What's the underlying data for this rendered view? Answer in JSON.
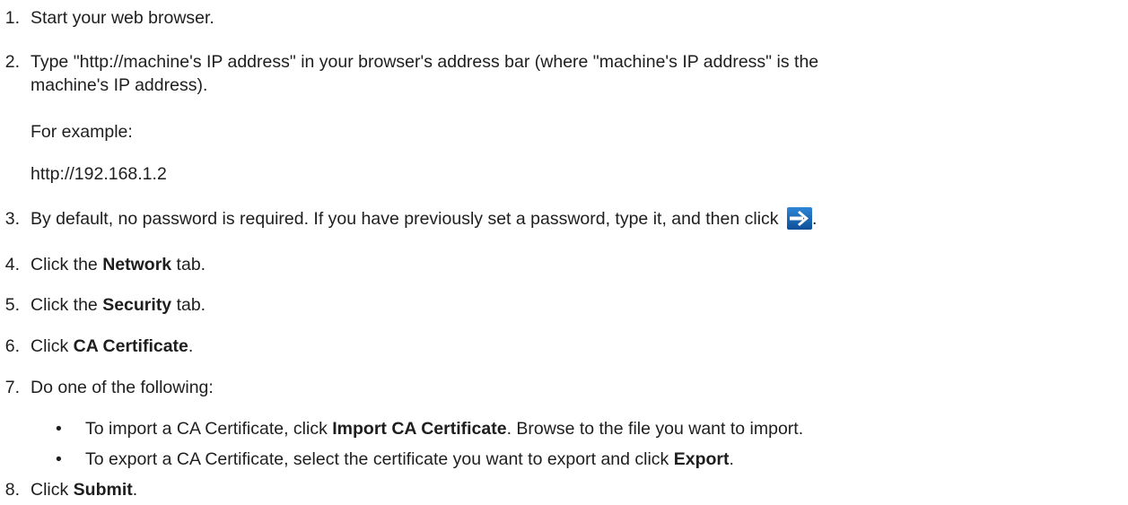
{
  "steps": [
    {
      "num": "1.",
      "text": "Start your web browser."
    },
    {
      "num": "2.",
      "line1": "Type \"http://machine's IP address\" in your browser's address bar (where \"machine's IP address\" is the",
      "line2": "machine's IP address).",
      "example_label": "For example:",
      "example_url": "http://192.168.1.2"
    },
    {
      "num": "3.",
      "text": "By default, no password is required. If you have previously set a password, type it, and then click",
      "after_icon": "."
    },
    {
      "num": "4.",
      "pre": "Click the ",
      "bold": "Network",
      "post": " tab."
    },
    {
      "num": "5.",
      "pre": "Click the ",
      "bold": "Security",
      "post": " tab."
    },
    {
      "num": "6.",
      "pre": "Click ",
      "bold": "CA Certificate",
      "post": "."
    },
    {
      "num": "7.",
      "text": "Do one of the following:"
    },
    {
      "num": "8.",
      "pre": "Click ",
      "bold": "Submit",
      "post": "."
    }
  ],
  "bullets": [
    {
      "dot": "•",
      "pre": "To import a CA Certificate, click ",
      "bold": "Import CA Certificate",
      "post": ". Browse to the file you want to import."
    },
    {
      "dot": "•",
      "pre": "To export a CA Certificate, select the certificate you want to export and click ",
      "bold": "Export",
      "post": "."
    }
  ],
  "icons": {
    "go_arrow": "go-arrow-icon",
    "arrow_bg": "#1a66b8",
    "arrow_fg": "#ffffff"
  }
}
